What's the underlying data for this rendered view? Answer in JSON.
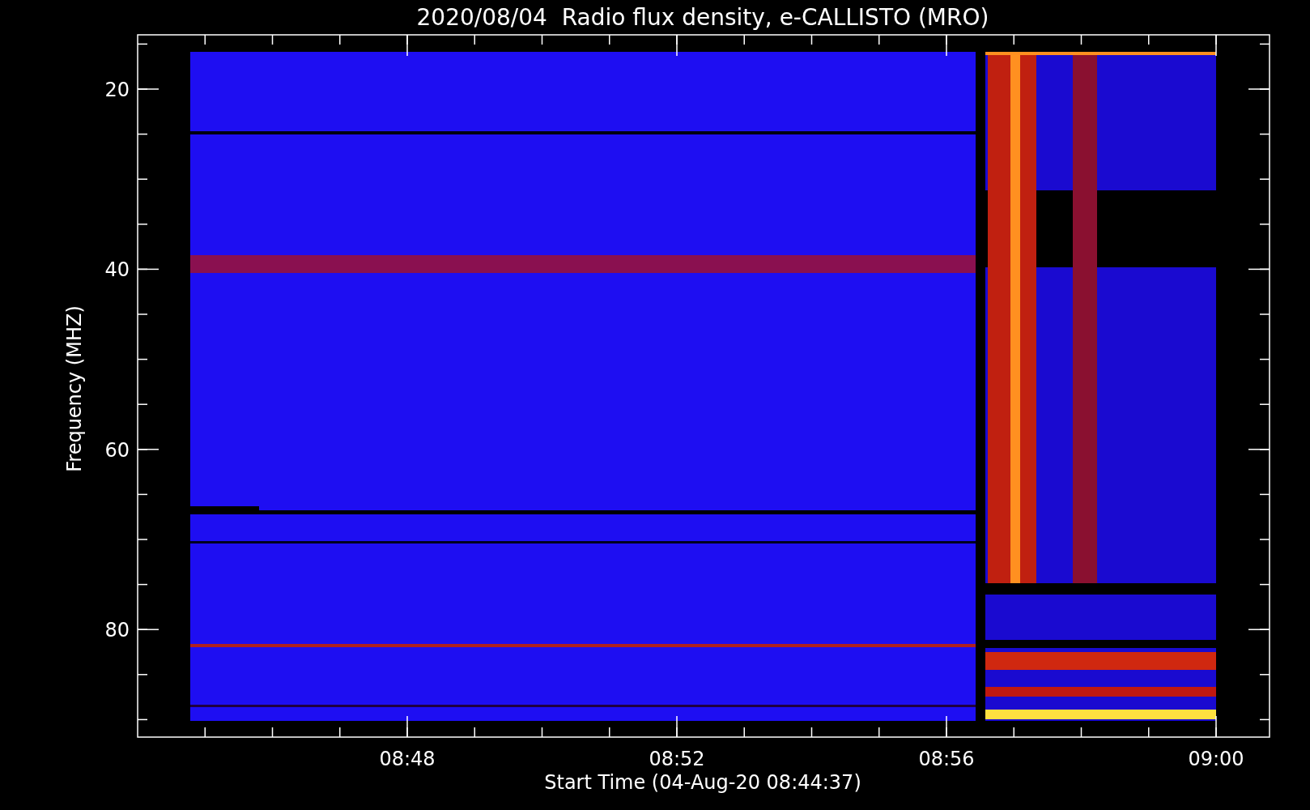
{
  "title": "2020/08/04  Radio flux density, e-CALLISTO (MRO)",
  "y_axis": {
    "label": "Frequency (MHZ)",
    "ticks": [
      "20",
      "40",
      "60",
      "80"
    ]
  },
  "x_axis": {
    "label": "Start Time (04-Aug-20 08:44:37)",
    "ticks": [
      "08:48",
      "08:52",
      "08:56",
      "09:00"
    ]
  }
}
